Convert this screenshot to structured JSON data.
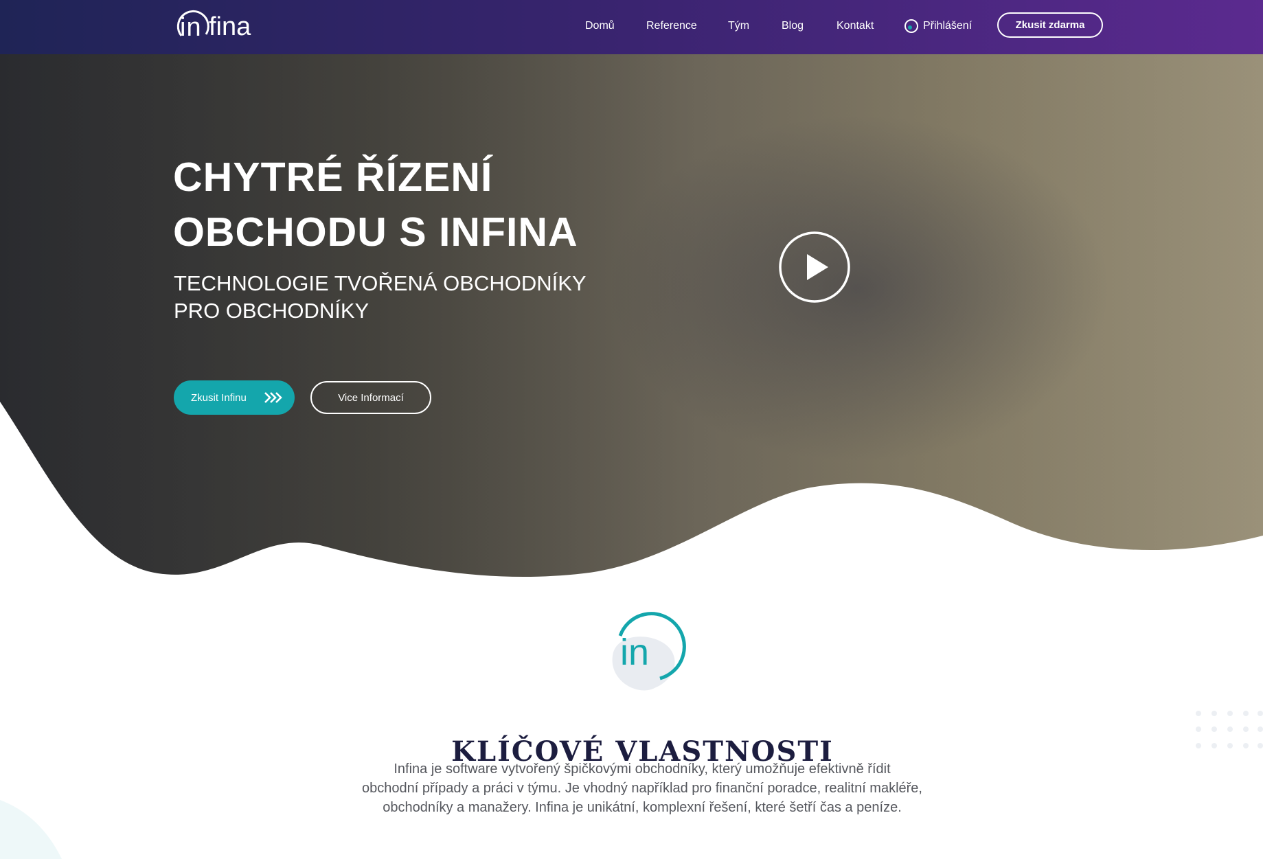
{
  "header": {
    "logo": {
      "mark_text": "in",
      "rest_text": "fina"
    },
    "nav": [
      {
        "label": "Domů"
      },
      {
        "label": "Reference"
      },
      {
        "label": "Tým"
      },
      {
        "label": "Blog"
      },
      {
        "label": "Kontakt"
      }
    ],
    "login_label": "Přihlášení",
    "cta_label": "Zkusit zdarma"
  },
  "hero": {
    "title_line1": "CHYTRÉ ŘÍZENÍ",
    "title_line2": "OBCHODU S INFINA",
    "subtitle_line1": "TECHNOLOGIE TVOŘENÁ OBCHODNÍKY",
    "subtitle_line2": "PRO OBCHODNÍKY",
    "primary_button": "Zkusit Infinu",
    "secondary_button": "Vice Informací"
  },
  "features": {
    "logo_text": "in",
    "title": "KLÍČOVÉ VLASTNOSTI",
    "text_line1": "Infina je software vytvořený špičkovými obchodníky, který umožňuje efektivně řídit",
    "text_line2": "obchodní případy a práci v týmu. Je vhodný například pro finanční poradce, realitní makléře,",
    "text_line3": "obchodníky a manažery. Infina je unikátní, komplexní řešení, které šetří čas a peníze."
  },
  "colors": {
    "header_gradient_start": "#1f2456",
    "header_gradient_end": "#5b2a8f",
    "accent_teal": "#14a6ac",
    "title_dark": "#1c1d3f",
    "body_text": "#55575d"
  },
  "icons": [
    "login-icon",
    "chevrons-right-icon",
    "play-icon"
  ]
}
